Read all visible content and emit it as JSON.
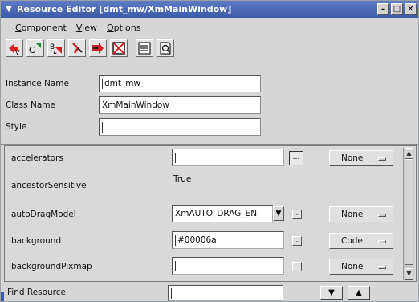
{
  "window": {
    "title": "Resource Editor [dmt_mw/XmMainWindow]",
    "accent_color": "#4a68b4",
    "buttons": [
      "minimize-icon",
      "maximize-icon",
      "close-icon"
    ]
  },
  "menubar": {
    "items": [
      {
        "pre": "",
        "key": "C",
        "rest": "omponent"
      },
      {
        "pre": "",
        "key": "V",
        "rest": "iew"
      },
      {
        "pre": "",
        "key": "O",
        "rest": "ptions"
      }
    ]
  },
  "toolbar": {
    "tools": [
      {
        "icon": "vertical-arrow-tool-icon",
        "glyph": "V"
      },
      {
        "icon": "callback-tool-icon",
        "glyph": "C"
      },
      {
        "icon": "bitmap-tool-icon",
        "glyph": "B"
      },
      {
        "icon": "link-tool-icon",
        "glyph": ""
      },
      {
        "icon": "arrow-tool-icon",
        "glyph": ""
      },
      {
        "icon": "grid-cross-tool-icon",
        "glyph": ""
      },
      {
        "icon": "list-view-icon",
        "glyph": ""
      },
      {
        "icon": "search-document-icon",
        "glyph": ""
      }
    ]
  },
  "instance": {
    "name_label": "Instance Name",
    "name_value": "dmt_mw",
    "class_label": "Class Name",
    "class_value": "XmMainWindow",
    "style_label": "Style",
    "style_value": ""
  },
  "resources": [
    {
      "name": "accelerators",
      "value": "",
      "editor": "input",
      "option": "None"
    },
    {
      "name": "ancestorSensitive",
      "value": "True",
      "editor": "text",
      "option": ""
    },
    {
      "name": "autoDragModel",
      "value": "XmAUTO_DRAG_EN",
      "editor": "combo",
      "option": "None"
    },
    {
      "name": "background",
      "value": "#00006a",
      "editor": "input",
      "option": "Code"
    },
    {
      "name": "backgroundPixmap",
      "value": "",
      "editor": "input",
      "option": "None"
    }
  ],
  "find": {
    "label": "Find Resource",
    "value": "",
    "prev_icon": "arrow-down-icon",
    "next_icon": "arrow-up-icon"
  }
}
